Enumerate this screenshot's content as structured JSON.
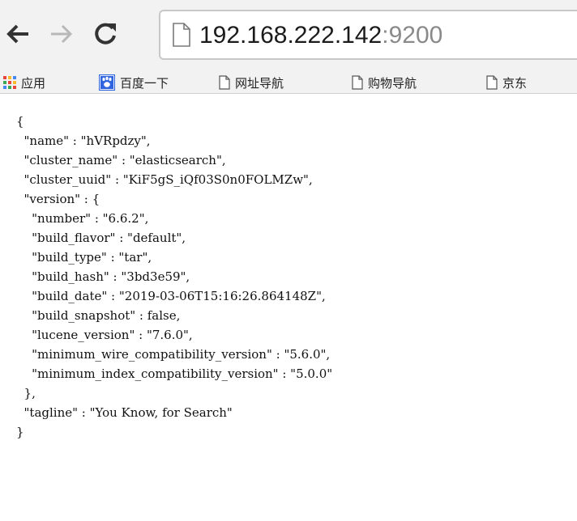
{
  "browser": {
    "url_host": "192.168.222.142",
    "url_port": ":9200"
  },
  "bookmarks": {
    "apps": "应用",
    "baidu": "百度一下",
    "url_nav": "网址导航",
    "shopping_nav": "购物导航",
    "jd": "京东"
  },
  "json_lines": [
    "{",
    "  \"name\" : \"hVRpdzy\",",
    "  \"cluster_name\" : \"elasticsearch\",",
    "  \"cluster_uuid\" : \"KiF5gS_iQf03S0n0FOLMZw\",",
    "  \"version\" : {",
    "    \"number\" : \"6.6.2\",",
    "    \"build_flavor\" : \"default\",",
    "    \"build_type\" : \"tar\",",
    "    \"build_hash\" : \"3bd3e59\",",
    "    \"build_date\" : \"2019-03-06T15:16:26.864148Z\",",
    "    \"build_snapshot\" : false,",
    "    \"lucene_version\" : \"7.6.0\",",
    "    \"minimum_wire_compatibility_version\" : \"5.6.0\",",
    "    \"minimum_index_compatibility_version\" : \"5.0.0\"",
    "  },",
    "  \"tagline\" : \"You Know, for Search\"",
    "}"
  ],
  "colors": {
    "toolbar_bg": "#f2f2f2",
    "url_port": "#8a8a8a",
    "apps_grid": [
      "#e8453c",
      "#f9bb2d",
      "#4688f1",
      "#3aa757"
    ],
    "baidu_blue": "#2f63e0"
  },
  "icons": {
    "back": "arrow-left-icon",
    "forward": "arrow-right-icon",
    "reload": "reload-icon",
    "page": "page-icon",
    "apps": "apps-grid-icon",
    "baidu": "baidu-paw-icon",
    "bookmark_page": "page-icon"
  }
}
